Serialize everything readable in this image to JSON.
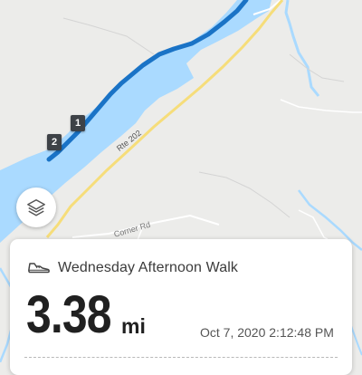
{
  "map": {
    "route_color": "#1a73c6",
    "water_color": "#aadaff",
    "highway_color": "#f6dd7a",
    "markers": [
      {
        "label": "1"
      },
      {
        "label": "2"
      }
    ],
    "road_labels": {
      "route": "Rte 202",
      "side_road": "Corner Rd"
    }
  },
  "controls": {
    "layers_icon": "layers-icon"
  },
  "activity": {
    "icon": "shoe-icon",
    "title": "Wednesday Afternoon Walk",
    "distance": "3.38",
    "unit": "mi",
    "datetime": "Oct 7, 2020 2:12:48 PM"
  }
}
